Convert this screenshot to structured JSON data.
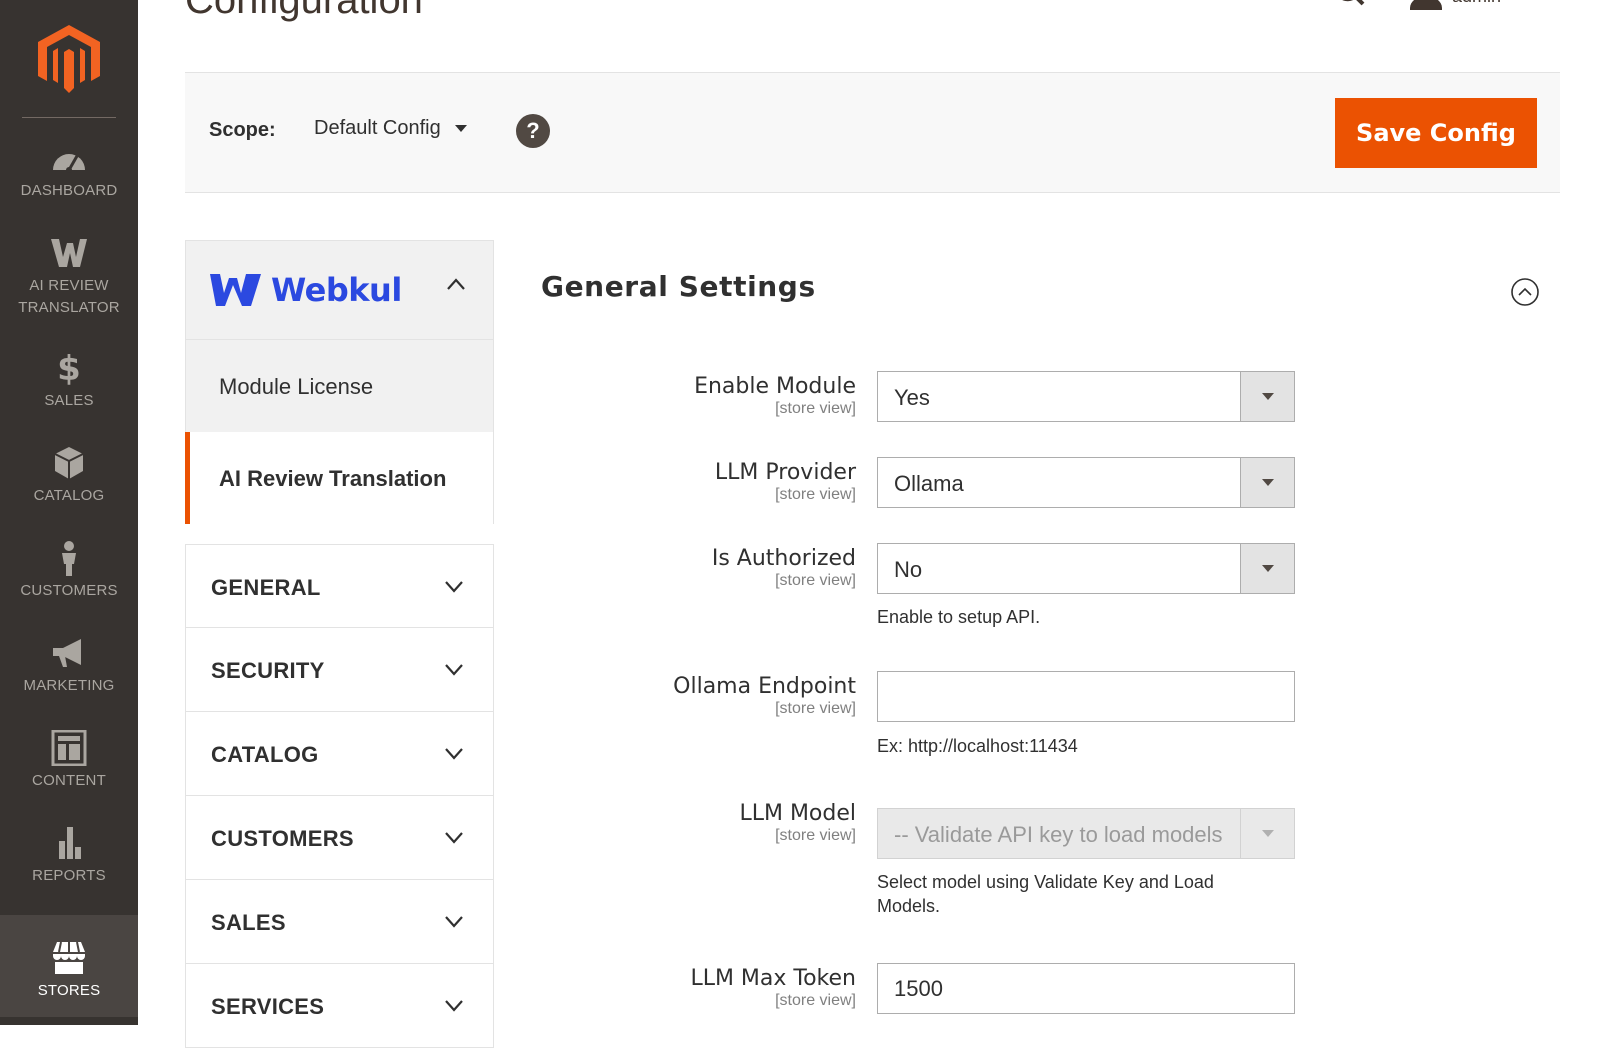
{
  "page": {
    "title": "Configuration",
    "user_name": "admin"
  },
  "nav": [
    {
      "key": "dashboard",
      "label": "DASHBOARD"
    },
    {
      "key": "ai-review",
      "label_line1": "AI REVIEW",
      "label_line2": "TRANSLATOR"
    },
    {
      "key": "sales",
      "label": "SALES"
    },
    {
      "key": "catalog",
      "label": "CATALOG"
    },
    {
      "key": "customers",
      "label": "CUSTOMERS"
    },
    {
      "key": "marketing",
      "label": "MARKETING"
    },
    {
      "key": "content",
      "label": "CONTENT"
    },
    {
      "key": "reports",
      "label": "REPORTS"
    },
    {
      "key": "stores",
      "label": "STORES",
      "active": true
    }
  ],
  "scope": {
    "label": "Scope:",
    "value": "Default Config",
    "help": "?"
  },
  "actions": {
    "save_label": "Save Config"
  },
  "sidebar": {
    "vendor": "Webkul",
    "items": [
      {
        "label": "Module License"
      },
      {
        "label": "AI Review Translation",
        "active": true
      }
    ],
    "sections": [
      {
        "label": "GENERAL"
      },
      {
        "label": "SECURITY"
      },
      {
        "label": "CATALOG"
      },
      {
        "label": "CUSTOMERS"
      },
      {
        "label": "SALES"
      },
      {
        "label": "SERVICES"
      }
    ]
  },
  "form": {
    "section_title": "General Settings",
    "fields": [
      {
        "label": "Enable Module",
        "scope": "[store view]",
        "type": "select",
        "value": "Yes"
      },
      {
        "label": "LLM Provider",
        "scope": "[store view]",
        "type": "select",
        "value": "Ollama"
      },
      {
        "label": "Is Authorized",
        "scope": "[store view]",
        "type": "select",
        "value": "No",
        "note": "Enable to setup API."
      },
      {
        "label": "Ollama Endpoint",
        "scope": "[store view]",
        "type": "text",
        "value": "",
        "note": "Ex: http://localhost:11434"
      },
      {
        "label": "LLM Model",
        "scope": "[store view]",
        "type": "select",
        "disabled": true,
        "value": "-- Validate API key to load models --",
        "note": "Select model using Validate Key and Load Models."
      },
      {
        "label": "LLM Max Token",
        "scope": "[store view]",
        "type": "text",
        "value": "1500"
      }
    ]
  },
  "colors": {
    "brand_orange": "#eb5202",
    "nav_bg": "#373330",
    "webkul_blue": "#2b49e0"
  }
}
